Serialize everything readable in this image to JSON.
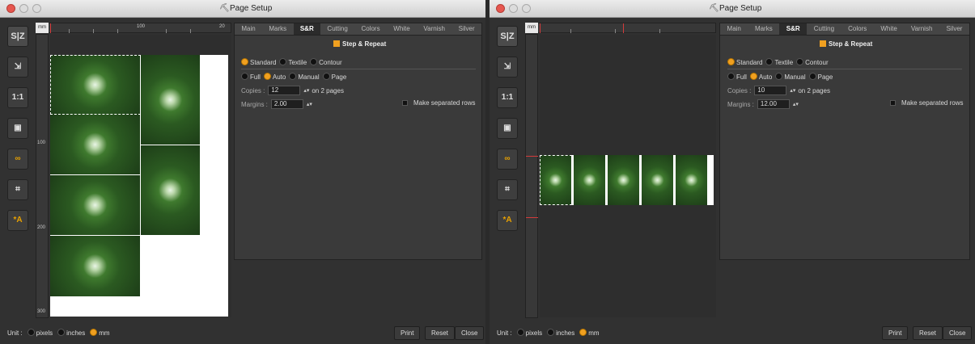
{
  "windows": [
    {
      "id": "left",
      "title": "Page Setup",
      "toolbar": [
        "S|Z",
        "export",
        "1:1",
        "fit",
        "link",
        "center",
        "auto-text"
      ],
      "ruler": {
        "unit": "mm",
        "top_labels": [
          "100",
          "20"
        ],
        "left_labels": [
          "100",
          "200",
          "300"
        ]
      },
      "tabs": [
        "Main",
        "Marks",
        "S&R",
        "Cutting",
        "Colors",
        "White",
        "Varnish",
        "Silver"
      ],
      "active_tab": "S&R",
      "step_repeat_label": "Step & Repeat",
      "mode_options": [
        "Standard",
        "Textile",
        "Contour"
      ],
      "fill_options": [
        "Full",
        "Auto",
        "Manual",
        "Page"
      ],
      "copies_label": "Copies :",
      "copies_value": "12",
      "pages_text": "on 2 pages",
      "margins_label": "Margins :",
      "margins_value": "2.00",
      "separated_rows_label": "Make separated rows",
      "unit_label": "Unit :",
      "unit_options": [
        "pixels",
        "inches",
        "mm"
      ],
      "buttons": [
        "Print",
        "Reset",
        "Close"
      ]
    },
    {
      "id": "right",
      "title": "Page Setup",
      "toolbar": [
        "S|Z",
        "export",
        "1:1",
        "fit",
        "link",
        "center",
        "auto-text"
      ],
      "ruler": {
        "unit": "mm",
        "top_labels": [],
        "left_labels": []
      },
      "tabs": [
        "Main",
        "Marks",
        "S&R",
        "Cutting",
        "Colors",
        "White",
        "Varnish",
        "Silver"
      ],
      "active_tab": "S&R",
      "step_repeat_label": "Step & Repeat",
      "mode_options": [
        "Standard",
        "Textile",
        "Contour"
      ],
      "fill_options": [
        "Full",
        "Auto",
        "Manual",
        "Page"
      ],
      "copies_label": "Copies :",
      "copies_value": "10",
      "pages_text": "on 2 pages",
      "margins_label": "Margins :",
      "margins_value": "12.00",
      "separated_rows_label": "Make separated rows",
      "unit_label": "Unit :",
      "unit_options": [
        "pixels",
        "inches",
        "mm"
      ],
      "buttons": [
        "Print",
        "Reset",
        "Close"
      ]
    }
  ],
  "colors": {
    "accent": "#f0a020",
    "panel": "#3a3a3a",
    "background": "#313131",
    "ruler_red": "#d43b3b"
  }
}
